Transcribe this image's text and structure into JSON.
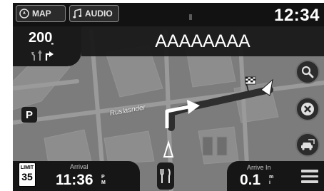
{
  "top_bar": {
    "map_tab": "MAP",
    "audio_tab": "AUDIO",
    "clock": "12:34"
  },
  "guidance": {
    "distance": "200̣",
    "street_name": "AAAAAAAA"
  },
  "map": {
    "road_label": "Ruslasnder"
  },
  "bottom_bar": {
    "speed_limit_label": "LIMIT",
    "speed_limit_value": "35",
    "arrival_label": "Arrival",
    "arrival_time": "11:36",
    "arrival_ampm": "P M",
    "arrive_in_label": "Arrive In",
    "arrive_in_value": "0.1",
    "arrive_in_unit": "m i"
  },
  "icons": {
    "map_tab": "compass-icon",
    "audio_tab": "music-note-icon",
    "parking": "P",
    "search": "magnifier-icon",
    "cancel": "close-icon",
    "traffic": "traffic-car-icon",
    "food": "fork-knife-icon",
    "menu": "hamburger-menu-icon"
  },
  "colors": {
    "route": "#3a3a3a",
    "map_background": "#7c7c7c",
    "panel": "#161616"
  }
}
